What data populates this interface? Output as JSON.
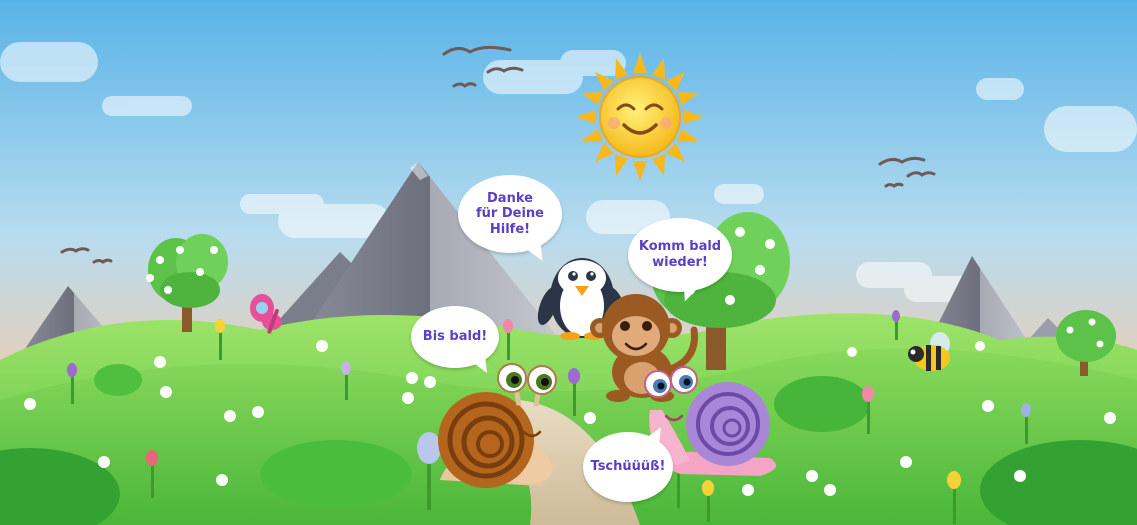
{
  "speech": {
    "penguin": "Danke\nfür Deine\nHilfe!",
    "monkey": "Komm bald\nwieder!",
    "snail_brown": "Bis bald!",
    "snail_pink": "Tschüüüß!"
  },
  "colors": {
    "sky_top": "#5ab4e8",
    "sky_bottom": "#f4c4a4",
    "grass": "#6fcf4a",
    "grass_dark": "#3fae3a",
    "bubble_text": "#5b3fc4",
    "sun": "#f8c92a"
  },
  "icons": [
    "sun-icon",
    "bird-icon",
    "mountain-icon",
    "tree-icon",
    "penguin-icon",
    "monkey-icon",
    "snail-icon",
    "butterfly-icon",
    "bee-icon",
    "flower-icon",
    "bush-icon"
  ]
}
